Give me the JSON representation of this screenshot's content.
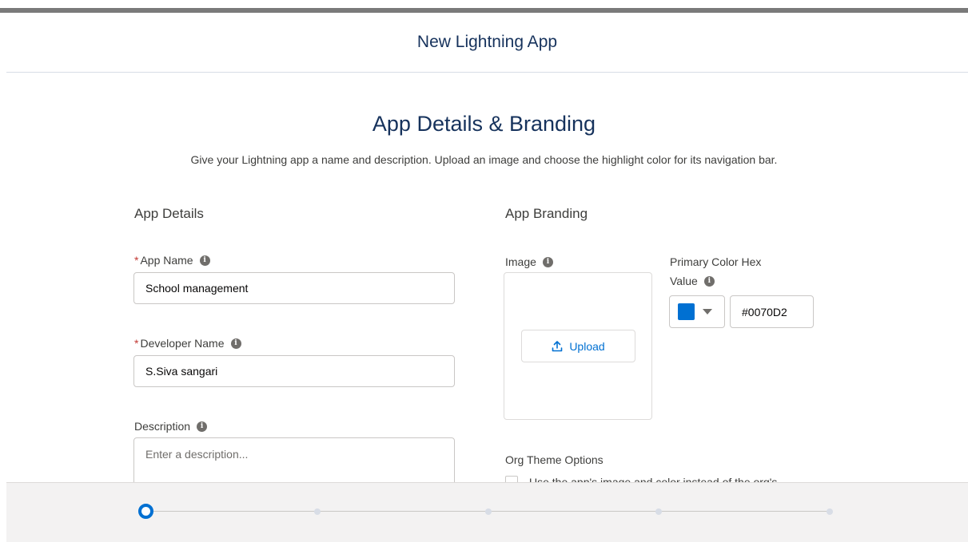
{
  "modal": {
    "title": "New Lightning App"
  },
  "step": {
    "title": "App Details & Branding",
    "description": "Give your Lightning app a name and description. Upload an image and choose the highlight color for its navigation bar."
  },
  "app_details": {
    "section_title": "App Details",
    "app_name_label": "App Name",
    "app_name_value": "School management",
    "developer_name_label": "Developer Name",
    "developer_name_value": "S.Siva sangari",
    "description_label": "Description",
    "description_placeholder": "Enter a description..."
  },
  "app_branding": {
    "section_title": "App Branding",
    "image_label": "Image",
    "upload_label": "Upload",
    "primary_color_label_line1": "Primary Color Hex",
    "primary_color_label_line2": "Value",
    "primary_color_value": "#0070D2",
    "swatch_color": "#0070d2",
    "org_theme_title": "Org Theme Options",
    "org_theme_checkbox_label": "Use the app's image and color instead of the org's"
  },
  "progress": {
    "current_step": 1,
    "total_steps": 5
  },
  "icons": {
    "info": "info-icon",
    "upload": "upload-icon",
    "caret": "chevron-down-icon"
  }
}
